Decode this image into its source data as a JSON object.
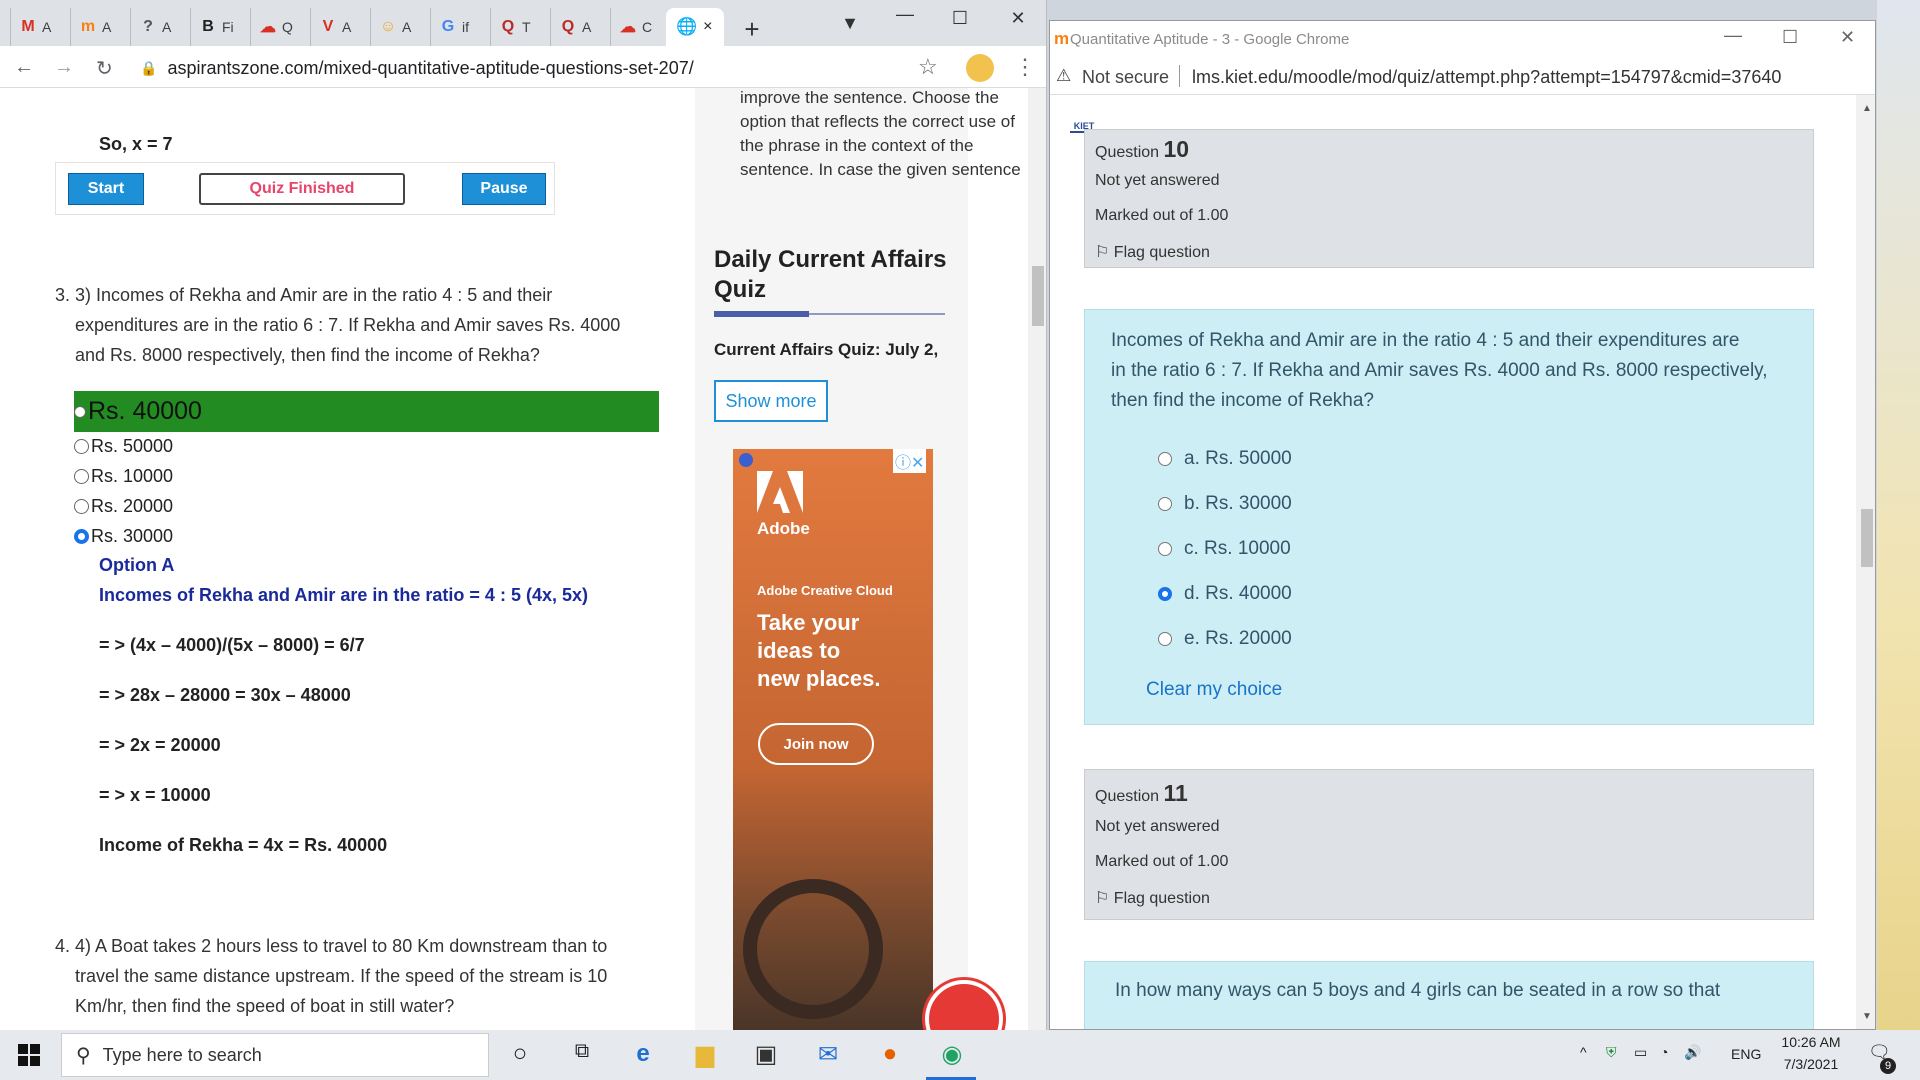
{
  "left_browser": {
    "tabs": [
      {
        "icon": "gmail-icon",
        "label": "A",
        "color": "#d93025",
        "glyph": "M"
      },
      {
        "icon": "moodle-icon",
        "label": "A",
        "color": "#f98012",
        "glyph": "m"
      },
      {
        "icon": "question-icon",
        "label": "A",
        "color": "#555555",
        "glyph": "?"
      },
      {
        "icon": "b-icon",
        "label": "Fi",
        "color": "#222222",
        "glyph": "B"
      },
      {
        "icon": "cloud-icon",
        "label": "Q",
        "color": "#d93025",
        "glyph": "☁"
      },
      {
        "icon": "v-icon",
        "label": "A",
        "color": "#d93025",
        "glyph": "V"
      },
      {
        "icon": "emoji-icon",
        "label": "A",
        "color": "#f4a623",
        "glyph": "☺"
      },
      {
        "icon": "google-icon",
        "label": "if",
        "color": "#4285f4",
        "glyph": "G"
      },
      {
        "icon": "quora-icon",
        "label": "T",
        "color": "#b92b27",
        "glyph": "Q"
      },
      {
        "icon": "quora-icon",
        "label": "A",
        "color": "#b92b27",
        "glyph": "Q"
      },
      {
        "icon": "cloud-icon",
        "label": "C",
        "color": "#d93025",
        "glyph": "☁"
      }
    ],
    "url": "aspirantszone.com/mixed-quantitative-aptitude-questions-set-207/",
    "new_tab": "+",
    "close_tab": "×",
    "minimize": "—",
    "maximize": "☐",
    "close": "✕",
    "menu": "⋮",
    "star": "☆"
  },
  "article": {
    "prev_answer": "So, x = 7",
    "controls": {
      "start": "Start",
      "status": "Quiz Finished",
      "pause": "Pause"
    },
    "q3": {
      "line1": "3. 3) Incomes of Rekha and Amir are in the ratio 4 : 5 and their",
      "line2": "expenditures are in the ratio 6 : 7. If Rekha and Amir saves Rs. 4000",
      "line3": "and Rs. 8000 respectively, then find the income of Rekha?",
      "correct_option": "Rs. 40000",
      "options": [
        "Rs. 50000",
        "Rs. 10000",
        "Rs. 20000",
        "Rs. 30000"
      ],
      "selected_index": 3
    },
    "solution": {
      "option": "Option A",
      "intro": "Incomes of Rekha and Amir are in the ratio = 4 : 5 (4x, 5x)",
      "step1": "= > (4x – 4000)/(5x – 8000) = 6/7",
      "step2": "= > 28x – 28000 = 30x – 48000",
      "step3": "= > 2x = 20000",
      "step4": "= > x = 10000",
      "result": "Income of Rekha = 4x = Rs. 40000"
    },
    "q4": {
      "line1": "4. 4) A Boat takes 2 hours less to travel to 80 Km downstream than to",
      "line2": "travel the same distance upstream. If the speed of the stream is 10",
      "line3": "Km/hr, then find the speed of boat in still water?"
    }
  },
  "sidebar": {
    "teaser1": "improve the sentence. Choose the",
    "teaser2": "option that reflects the correct use of",
    "teaser3": "the phrase in the context of the",
    "teaser4": "sentence. In case the given sentence",
    "title1": "Daily Current Affairs",
    "title2": "Quiz",
    "link": "Current Affairs Quiz: July 2,",
    "show_more": "Show more",
    "ad": {
      "brand": "Adobe",
      "product": "Adobe Creative Cloud",
      "tag1": "Take your",
      "tag2": "ideas to",
      "tag3": "new places.",
      "cta": "Join now"
    }
  },
  "right_browser": {
    "title": "Quantitative Aptitude - 3 - Google Chrome",
    "security": "Not secure",
    "url": "lms.kiet.edu/moodle/mod/quiz/attempt.php?attempt=154797&cmid=37640",
    "logo": "KIET",
    "q10": {
      "label": "Question",
      "number": "10",
      "state": "Not yet answered",
      "marks": "Marked out of 1.00",
      "flag": "Flag question",
      "text1": "Incomes of Rekha and Amir are in the ratio 4 : 5 and their expenditures are",
      "text2": "in the ratio 6 : 7. If Rekha and Amir saves Rs. 4000 and Rs. 8000 respectively,",
      "text3": "then find the income of Rekha?",
      "options": [
        "a. Rs. 50000",
        "b. Rs. 30000",
        "c. Rs. 10000",
        "d. Rs. 40000",
        "e. Rs. 20000"
      ],
      "selected_index": 3,
      "clear": "Clear my choice"
    },
    "q11": {
      "label": "Question",
      "number": "11",
      "state": "Not yet answered",
      "marks": "Marked out of 1.00",
      "flag": "Flag question",
      "text1": "In how many ways can 5 boys and 4 girls can be seated in a row so that"
    }
  },
  "taskbar": {
    "search_placeholder": "Type here to search",
    "lang": "ENG",
    "time": "10:26 AM",
    "date": "7/3/2021",
    "notifications": "9"
  },
  "colors": {
    "correct_green": "#228b22",
    "start_blue": "#1e90d8",
    "quiz_pink": "#e8456b",
    "moodle_info_bg": "#dee2e6",
    "moodle_body_bg": "#cdeef4"
  }
}
